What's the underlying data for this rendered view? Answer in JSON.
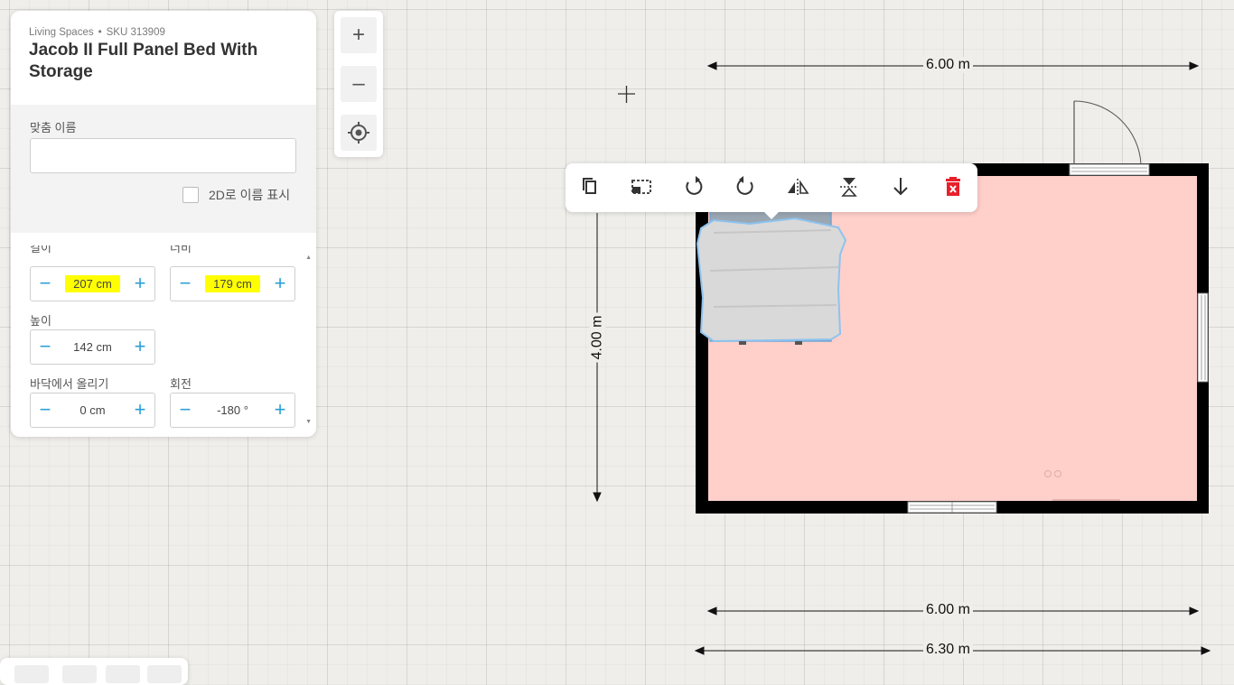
{
  "product": {
    "brand": "Living Spaces",
    "sku": "SKU 313909",
    "title": "Jacob II Full Panel Bed With Storage"
  },
  "custom_name": {
    "label": "맞춤 이름",
    "value": "",
    "show_2d_label": "2D로 이름 표시",
    "show_2d_checked": false
  },
  "dimensions": {
    "length": {
      "label": "길이",
      "value": "207 cm"
    },
    "width": {
      "label": "너비",
      "value": "179 cm"
    },
    "height": {
      "label": "높이",
      "value": "142 cm"
    },
    "elevation": {
      "label": "바닥에서 올리기",
      "value": "0 cm"
    },
    "rotation": {
      "label": "회전",
      "value": "-180 °"
    }
  },
  "zoom": {
    "zoom_in": "+",
    "zoom_out": "–"
  },
  "toolbar": {
    "tools": [
      "copy-icon",
      "group-select-icon",
      "rotate-left-icon",
      "rotate-right-icon",
      "flip-horizontal-icon",
      "flip-vertical-icon",
      "move-down-icon",
      "delete-icon"
    ],
    "delete_color": "#e8202a"
  },
  "floor_plan": {
    "room_fill": "#ffcfca",
    "wall_color": "#000000",
    "top_dimension": "6.00 m",
    "left_dimension": "4.00 m",
    "bottom_inner_dimension": "6.00 m",
    "bottom_outer_dimension": "6.30 m"
  }
}
